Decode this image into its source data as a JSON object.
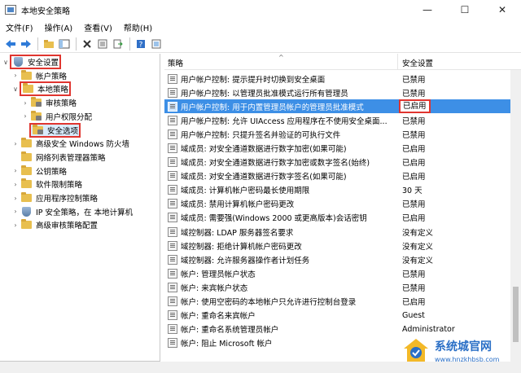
{
  "window": {
    "title": "本地安全策略",
    "minimize": "—",
    "maximize": "☐",
    "close": "✕"
  },
  "menu": [
    "文件(F)",
    "操作(A)",
    "查看(V)",
    "帮助(H)"
  ],
  "toolbar": [
    "back-arrow-icon",
    "forward-arrow-icon",
    "folder-up-icon",
    "console-tree-icon",
    "delete-icon",
    "properties-icon",
    "export-icon",
    "help-icon",
    "view-icon"
  ],
  "tree": [
    {
      "label": "安全设置",
      "level": 0,
      "chev": "∨",
      "icon": "shield",
      "box": true
    },
    {
      "label": "帐户策略",
      "level": 1,
      "chev": "›",
      "icon": "folder"
    },
    {
      "label": "本地策略",
      "level": 1,
      "chev": "∨",
      "icon": "folder",
      "box": true
    },
    {
      "label": "审核策略",
      "level": 2,
      "chev": "›",
      "icon": "lockfolder"
    },
    {
      "label": "用户权限分配",
      "level": 2,
      "chev": "›",
      "icon": "lockfolder"
    },
    {
      "label": "安全选项",
      "level": 2,
      "chev": "",
      "icon": "lockfolder",
      "box": true,
      "selected": true
    },
    {
      "label": "高级安全 Windows 防火墙",
      "level": 1,
      "chev": "›",
      "icon": "folder"
    },
    {
      "label": "网络列表管理器策略",
      "level": 1,
      "chev": "",
      "icon": "folder"
    },
    {
      "label": "公钥策略",
      "level": 1,
      "chev": "›",
      "icon": "folder"
    },
    {
      "label": "软件限制策略",
      "level": 1,
      "chev": "›",
      "icon": "folder"
    },
    {
      "label": "应用程序控制策略",
      "level": 1,
      "chev": "›",
      "icon": "folder"
    },
    {
      "label": "IP 安全策略，在 本地计算机",
      "level": 1,
      "chev": "›",
      "icon": "shield"
    },
    {
      "label": "高级审核策略配置",
      "level": 1,
      "chev": "›",
      "icon": "folder"
    }
  ],
  "list": {
    "col_policy": "策略",
    "col_setting": "安全设置",
    "rows": [
      {
        "policy": "用户帐户控制: 提示提升时切换到安全桌面",
        "setting": "已禁用"
      },
      {
        "policy": "用户帐户控制: 以管理员批准模式运行所有管理员",
        "setting": "已禁用"
      },
      {
        "policy": "用户帐户控制: 用于内置管理员帐户的管理员批准模式",
        "setting": "已启用",
        "selected": true
      },
      {
        "policy": "用户帐户控制: 允许 UIAccess 应用程序在不使用安全桌面...",
        "setting": "已禁用"
      },
      {
        "policy": "用户帐户控制: 只提升签名并验证的可执行文件",
        "setting": "已禁用"
      },
      {
        "policy": "域成员: 对安全通道数据进行数字加密(如果可能)",
        "setting": "已启用"
      },
      {
        "policy": "域成员: 对安全通道数据进行数字加密或数字签名(始终)",
        "setting": "已启用"
      },
      {
        "policy": "域成员: 对安全通道数据进行数字签名(如果可能)",
        "setting": "已启用"
      },
      {
        "policy": "域成员: 计算机帐户密码最长使用期限",
        "setting": "30 天"
      },
      {
        "policy": "域成员: 禁用计算机帐户密码更改",
        "setting": "已禁用"
      },
      {
        "policy": "域成员: 需要强(Windows 2000 或更高版本)会话密钥",
        "setting": "已启用"
      },
      {
        "policy": "域控制器: LDAP 服务器签名要求",
        "setting": "没有定义"
      },
      {
        "policy": "域控制器: 拒绝计算机帐户密码更改",
        "setting": "没有定义"
      },
      {
        "policy": "域控制器: 允许服务器操作者计划任务",
        "setting": "没有定义"
      },
      {
        "policy": "帐户: 管理员帐户状态",
        "setting": "已禁用"
      },
      {
        "policy": "帐户: 来宾帐户状态",
        "setting": "已禁用"
      },
      {
        "policy": "帐户: 使用空密码的本地帐户只允许进行控制台登录",
        "setting": "已启用"
      },
      {
        "policy": "帐户: 重命名来宾帐户",
        "setting": "Guest"
      },
      {
        "policy": "帐户: 重命名系统管理员帐户",
        "setting": "Administrator"
      },
      {
        "policy": "帐户: 阻止 Microsoft 帐户",
        "setting": ""
      }
    ]
  },
  "watermark": {
    "name": "系统城官网",
    "url": "www.hnzkhbsb.com"
  },
  "colors": {
    "selection": "#3d8fe6",
    "highlight_box": "#e0352f",
    "folder": "#e8bf4f"
  }
}
